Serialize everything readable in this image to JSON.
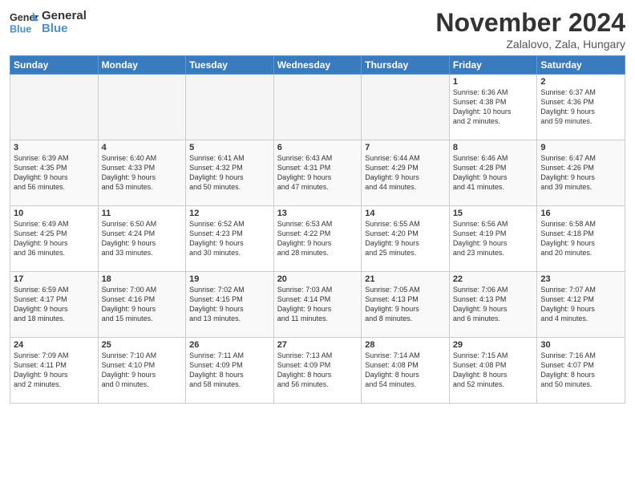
{
  "header": {
    "logo_line1": "General",
    "logo_line2": "Blue",
    "month_title": "November 2024",
    "location": "Zalalovo, Zala, Hungary"
  },
  "days_of_week": [
    "Sunday",
    "Monday",
    "Tuesday",
    "Wednesday",
    "Thursday",
    "Friday",
    "Saturday"
  ],
  "weeks": [
    [
      {
        "day": "",
        "info": ""
      },
      {
        "day": "",
        "info": ""
      },
      {
        "day": "",
        "info": ""
      },
      {
        "day": "",
        "info": ""
      },
      {
        "day": "",
        "info": ""
      },
      {
        "day": "1",
        "info": "Sunrise: 6:36 AM\nSunset: 4:38 PM\nDaylight: 10 hours\nand 2 minutes."
      },
      {
        "day": "2",
        "info": "Sunrise: 6:37 AM\nSunset: 4:36 PM\nDaylight: 9 hours\nand 59 minutes."
      }
    ],
    [
      {
        "day": "3",
        "info": "Sunrise: 6:39 AM\nSunset: 4:35 PM\nDaylight: 9 hours\nand 56 minutes."
      },
      {
        "day": "4",
        "info": "Sunrise: 6:40 AM\nSunset: 4:33 PM\nDaylight: 9 hours\nand 53 minutes."
      },
      {
        "day": "5",
        "info": "Sunrise: 6:41 AM\nSunset: 4:32 PM\nDaylight: 9 hours\nand 50 minutes."
      },
      {
        "day": "6",
        "info": "Sunrise: 6:43 AM\nSunset: 4:31 PM\nDaylight: 9 hours\nand 47 minutes."
      },
      {
        "day": "7",
        "info": "Sunrise: 6:44 AM\nSunset: 4:29 PM\nDaylight: 9 hours\nand 44 minutes."
      },
      {
        "day": "8",
        "info": "Sunrise: 6:46 AM\nSunset: 4:28 PM\nDaylight: 9 hours\nand 41 minutes."
      },
      {
        "day": "9",
        "info": "Sunrise: 6:47 AM\nSunset: 4:26 PM\nDaylight: 9 hours\nand 39 minutes."
      }
    ],
    [
      {
        "day": "10",
        "info": "Sunrise: 6:49 AM\nSunset: 4:25 PM\nDaylight: 9 hours\nand 36 minutes."
      },
      {
        "day": "11",
        "info": "Sunrise: 6:50 AM\nSunset: 4:24 PM\nDaylight: 9 hours\nand 33 minutes."
      },
      {
        "day": "12",
        "info": "Sunrise: 6:52 AM\nSunset: 4:23 PM\nDaylight: 9 hours\nand 30 minutes."
      },
      {
        "day": "13",
        "info": "Sunrise: 6:53 AM\nSunset: 4:22 PM\nDaylight: 9 hours\nand 28 minutes."
      },
      {
        "day": "14",
        "info": "Sunrise: 6:55 AM\nSunset: 4:20 PM\nDaylight: 9 hours\nand 25 minutes."
      },
      {
        "day": "15",
        "info": "Sunrise: 6:56 AM\nSunset: 4:19 PM\nDaylight: 9 hours\nand 23 minutes."
      },
      {
        "day": "16",
        "info": "Sunrise: 6:58 AM\nSunset: 4:18 PM\nDaylight: 9 hours\nand 20 minutes."
      }
    ],
    [
      {
        "day": "17",
        "info": "Sunrise: 6:59 AM\nSunset: 4:17 PM\nDaylight: 9 hours\nand 18 minutes."
      },
      {
        "day": "18",
        "info": "Sunrise: 7:00 AM\nSunset: 4:16 PM\nDaylight: 9 hours\nand 15 minutes."
      },
      {
        "day": "19",
        "info": "Sunrise: 7:02 AM\nSunset: 4:15 PM\nDaylight: 9 hours\nand 13 minutes."
      },
      {
        "day": "20",
        "info": "Sunrise: 7:03 AM\nSunset: 4:14 PM\nDaylight: 9 hours\nand 11 minutes."
      },
      {
        "day": "21",
        "info": "Sunrise: 7:05 AM\nSunset: 4:13 PM\nDaylight: 9 hours\nand 8 minutes."
      },
      {
        "day": "22",
        "info": "Sunrise: 7:06 AM\nSunset: 4:13 PM\nDaylight: 9 hours\nand 6 minutes."
      },
      {
        "day": "23",
        "info": "Sunrise: 7:07 AM\nSunset: 4:12 PM\nDaylight: 9 hours\nand 4 minutes."
      }
    ],
    [
      {
        "day": "24",
        "info": "Sunrise: 7:09 AM\nSunset: 4:11 PM\nDaylight: 9 hours\nand 2 minutes."
      },
      {
        "day": "25",
        "info": "Sunrise: 7:10 AM\nSunset: 4:10 PM\nDaylight: 9 hours\nand 0 minutes."
      },
      {
        "day": "26",
        "info": "Sunrise: 7:11 AM\nSunset: 4:09 PM\nDaylight: 8 hours\nand 58 minutes."
      },
      {
        "day": "27",
        "info": "Sunrise: 7:13 AM\nSunset: 4:09 PM\nDaylight: 8 hours\nand 56 minutes."
      },
      {
        "day": "28",
        "info": "Sunrise: 7:14 AM\nSunset: 4:08 PM\nDaylight: 8 hours\nand 54 minutes."
      },
      {
        "day": "29",
        "info": "Sunrise: 7:15 AM\nSunset: 4:08 PM\nDaylight: 8 hours\nand 52 minutes."
      },
      {
        "day": "30",
        "info": "Sunrise: 7:16 AM\nSunset: 4:07 PM\nDaylight: 8 hours\nand 50 minutes."
      }
    ]
  ]
}
